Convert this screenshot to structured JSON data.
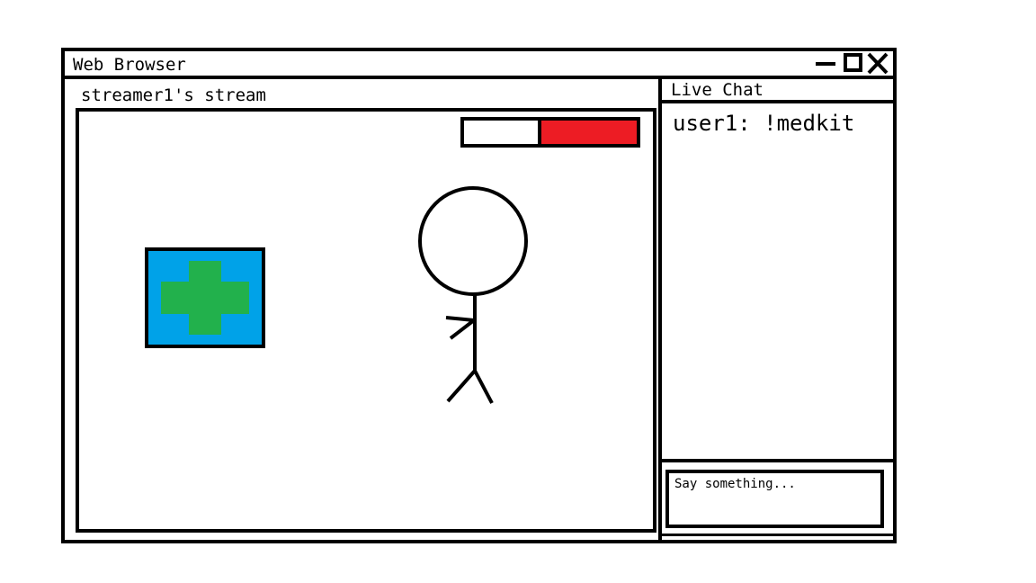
{
  "window": {
    "title": "Web Browser",
    "controls": [
      "minimize-icon",
      "maximize-icon",
      "close-icon"
    ]
  },
  "stream": {
    "title": "streamer1's stream",
    "health": 0.55,
    "colors": {
      "health_fill": "#ed1c24",
      "medkit_bg": "#00a2e8",
      "medkit_cross": "#22b14c"
    },
    "icons": [
      "medkit-icon",
      "stick-figure"
    ]
  },
  "chat": {
    "header": "Live Chat",
    "messages": [
      {
        "text": "user1: !medkit"
      }
    ],
    "input_placeholder": "Say something..."
  }
}
